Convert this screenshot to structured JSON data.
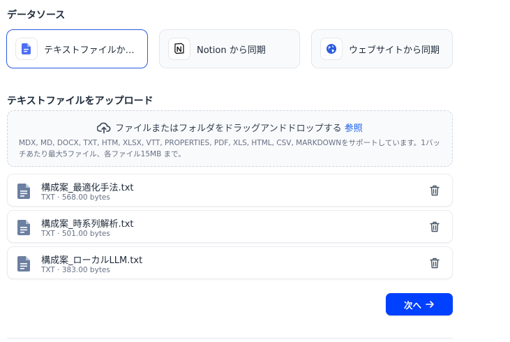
{
  "data_source": {
    "title": "データソース",
    "options": [
      {
        "label": "テキストファイルか…",
        "icon": "document-icon",
        "selected": true
      },
      {
        "label": "Notion から同期",
        "icon": "notion-logo-icon",
        "selected": false
      },
      {
        "label": "ウェブサイトから同期",
        "icon": "globe-icon",
        "selected": false
      }
    ]
  },
  "upload": {
    "title": "テキストファイルをアップロード",
    "drop_text": "ファイルまたはフォルダをドラッグアンドドロップする",
    "browse_label": "参照",
    "supported_note": "MDX, MD, DOCX, TXT, HTM, XLSX, VTT, PROPERTIES, PDF, XLS, HTML, CSV, MARKDOWNをサポートしています。1バッチあたり最大5ファイル、各ファイル15MB まで。"
  },
  "files": [
    {
      "name": "構成案_最適化手法.txt",
      "type": "TXT",
      "size": "568.00 bytes"
    },
    {
      "name": "構成案_時系列解析.txt",
      "type": "TXT",
      "size": "501.00 bytes"
    },
    {
      "name": "構成案_ローカルLLM.txt",
      "type": "TXT",
      "size": "383.00 bytes"
    }
  ],
  "next_button": {
    "label": "次へ"
  },
  "colors": {
    "primary": "#0040ff",
    "selected_border": "#2b5bdf",
    "icon_blue": "#4e6ef2",
    "file_icon": "#6b7fa0"
  }
}
